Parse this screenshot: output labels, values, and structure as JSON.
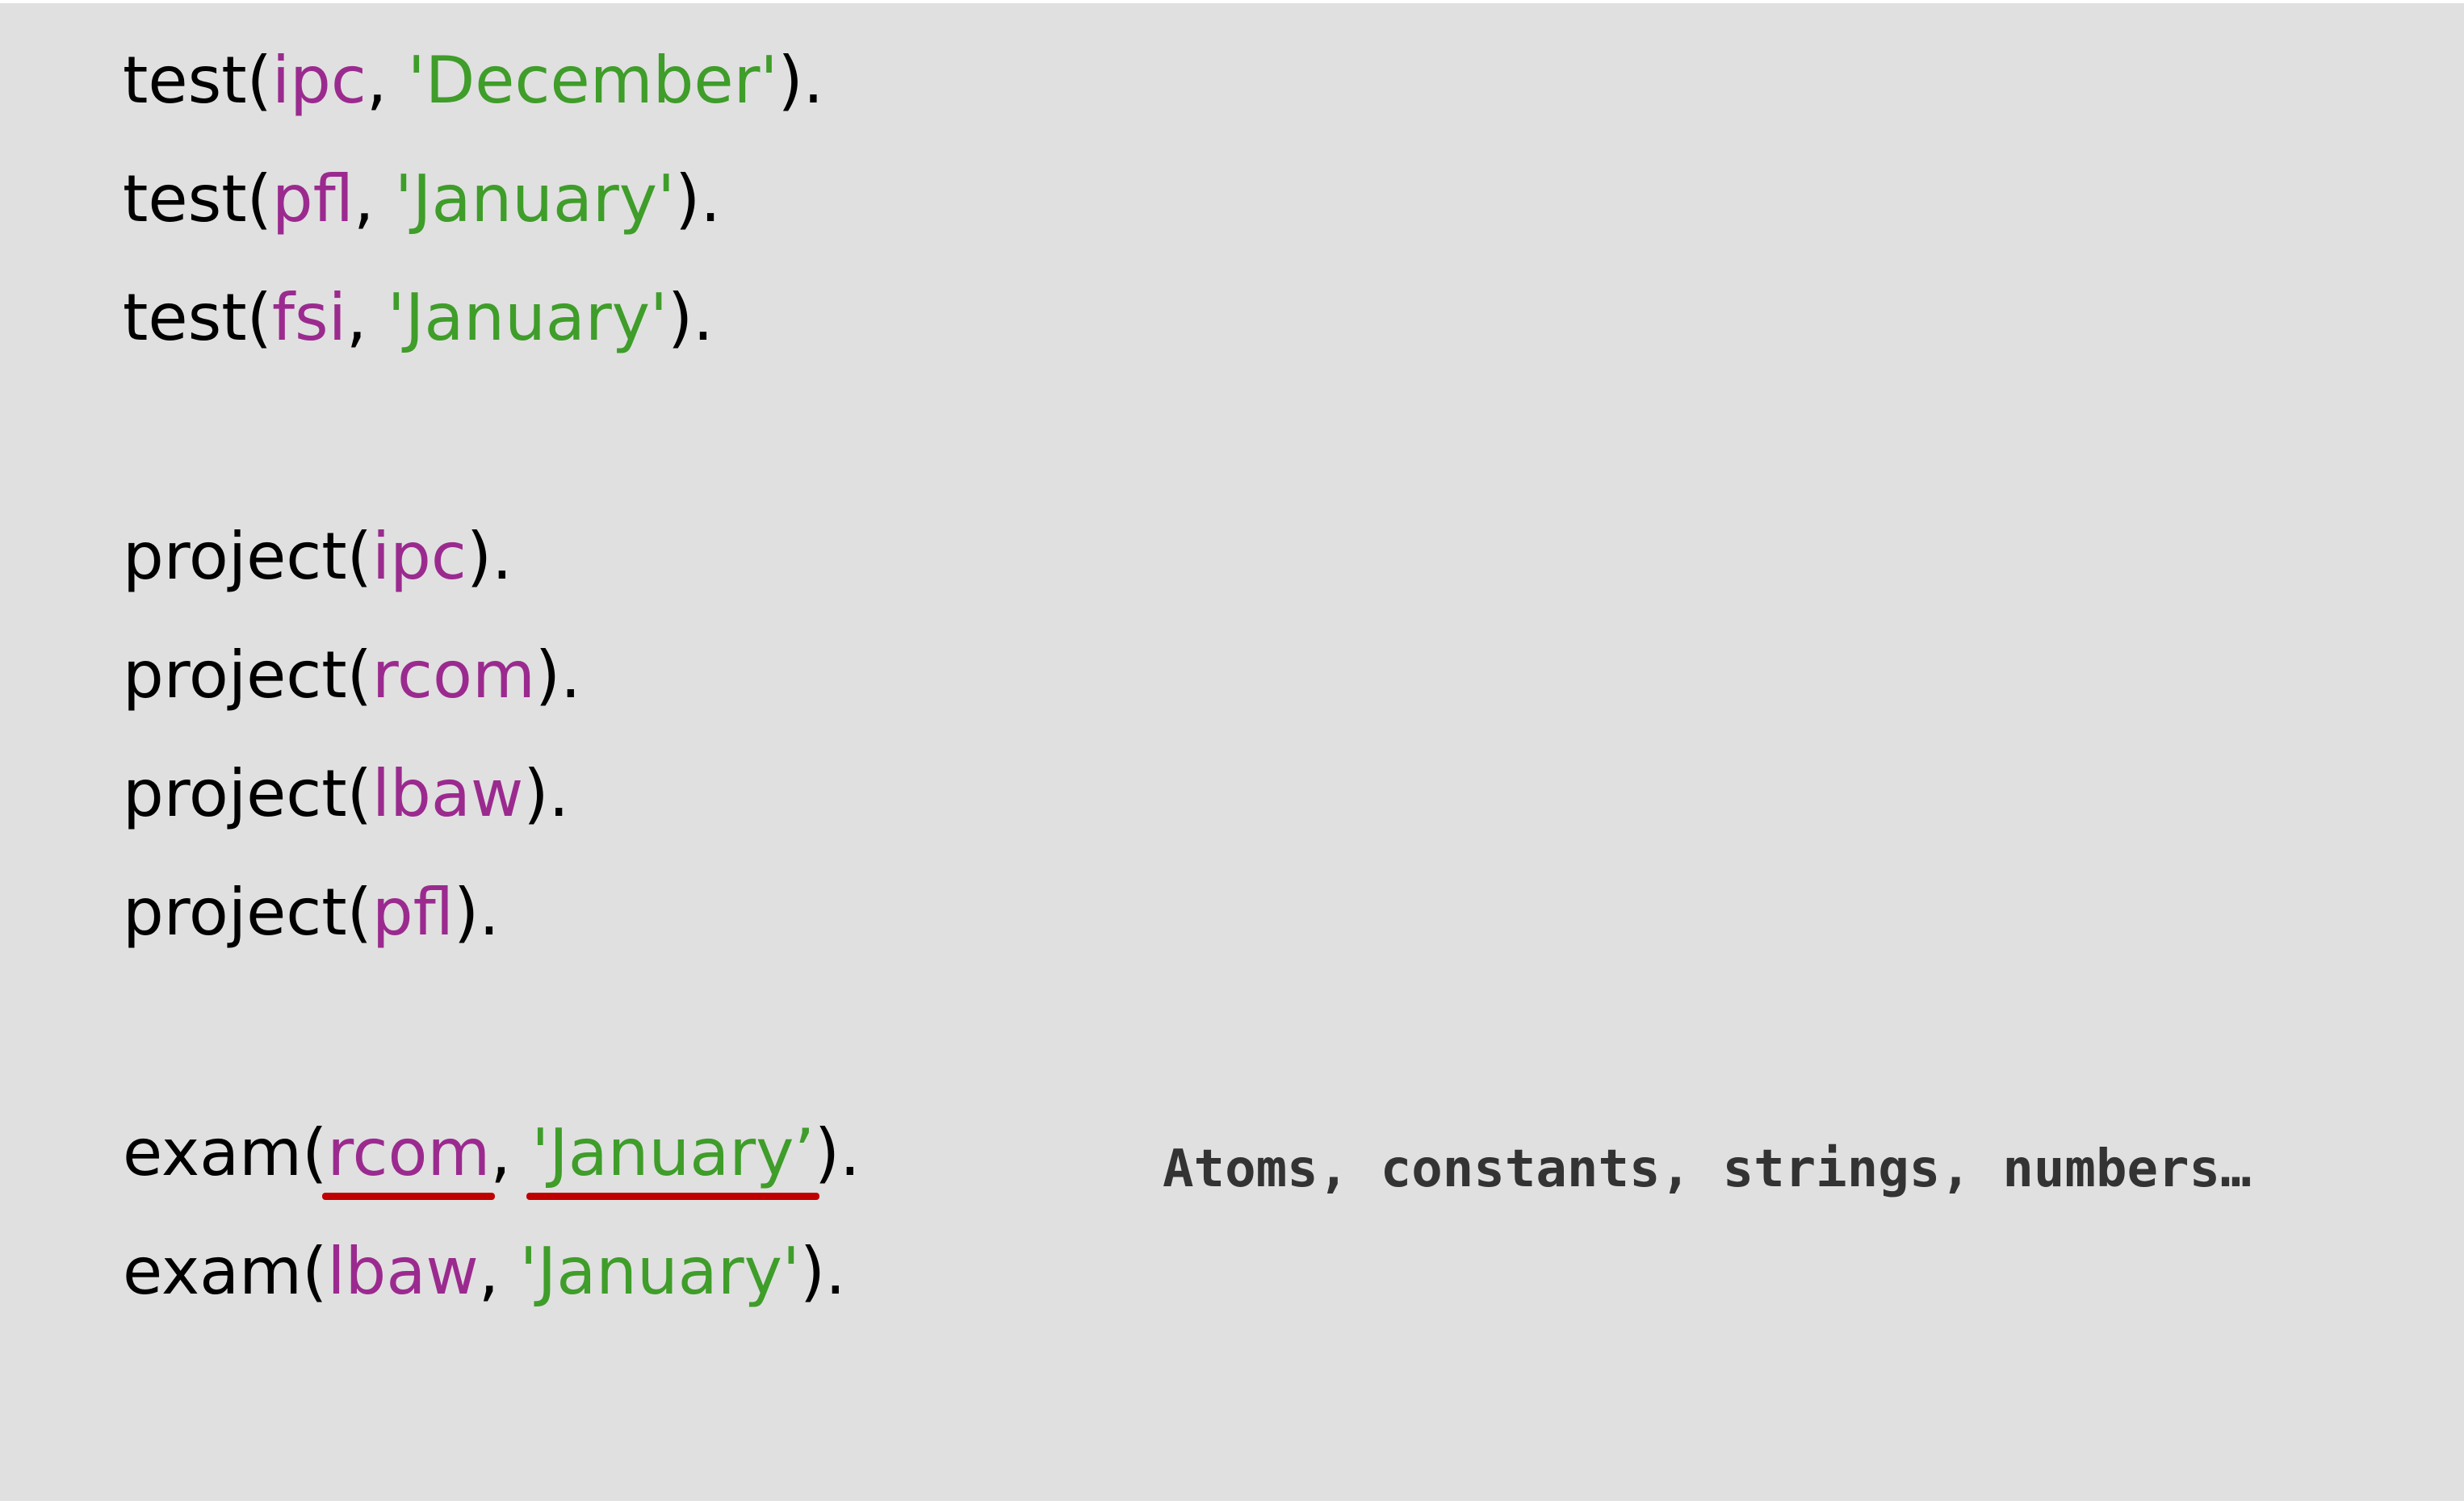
{
  "lines": [
    {
      "functor": "test(",
      "atom": "ipc",
      "sep": ", ",
      "str": "'December'",
      "end": ")."
    },
    {
      "functor": "test(",
      "atom": "pfl",
      "sep": ", ",
      "str": "'January'",
      "end": ")."
    },
    {
      "functor": "test(",
      "atom": "fsi",
      "sep": ", ",
      "str": "'January'",
      "end": ")."
    },
    {
      "functor": "project(",
      "atom": "ipc",
      "end": ")."
    },
    {
      "functor": "project(",
      "atom": "rcom",
      "end": ")."
    },
    {
      "functor": "project(",
      "atom": "lbaw",
      "end": ")."
    },
    {
      "functor": "project(",
      "atom": "pfl",
      "end": ")."
    },
    {
      "functor": "exam(",
      "atom": "rcom",
      "sep": ", ",
      "str": "'January’",
      "end": ")."
    },
    {
      "functor": "exam(",
      "atom": "lbaw",
      "sep": ", ",
      "str": "'January'",
      "end": ")."
    }
  ],
  "annotation": "Atoms, constants, strings, numbers…",
  "colors": {
    "background": "#e0e0e0",
    "atom": "#9b2a8f",
    "string": "#3f9d2a",
    "underline": "#c00000",
    "text": "#000000"
  }
}
